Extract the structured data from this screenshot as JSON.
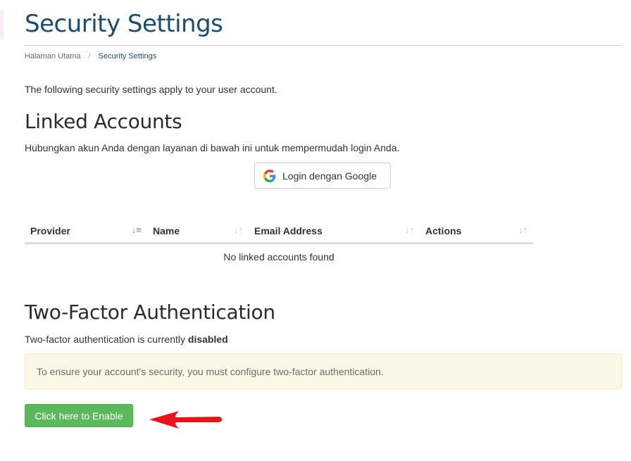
{
  "page": {
    "title": "Security Settings",
    "intro": "The following security settings apply to your user account."
  },
  "breadcrumb": {
    "home": "Halaman Utama",
    "separator": "/",
    "current": "Security Settings"
  },
  "linked_accounts": {
    "heading": "Linked Accounts",
    "description": "Hubungkan akun Anda dengan layanan di bawah ini untuk mempermudah login Anda.",
    "google_button_label": "Login dengan Google",
    "google_icon": "google-icon",
    "table": {
      "columns": [
        {
          "label": "Provider",
          "sort_icon": "sort-ascending-icon"
        },
        {
          "label": "Name",
          "sort_icon": "sort-icon"
        },
        {
          "label": "Email Address",
          "sort_icon": "sort-icon"
        },
        {
          "label": "Actions",
          "sort_icon": "sort-icon"
        }
      ],
      "empty_message": "No linked accounts found"
    }
  },
  "two_factor": {
    "heading": "Two-Factor Authentication",
    "status_prefix": "Two-factor authentication is currently",
    "status_value": "disabled",
    "alert_message": "To ensure your account's security, you must configure two-factor authentication.",
    "enable_button_label": "Click here to Enable",
    "arrow_icon": "red-arrow-left-icon"
  },
  "colors": {
    "title": "#1d4b6e",
    "success": "#5cb85c",
    "warning_bg": "#fcf8e8",
    "arrow": "#e8141a"
  }
}
